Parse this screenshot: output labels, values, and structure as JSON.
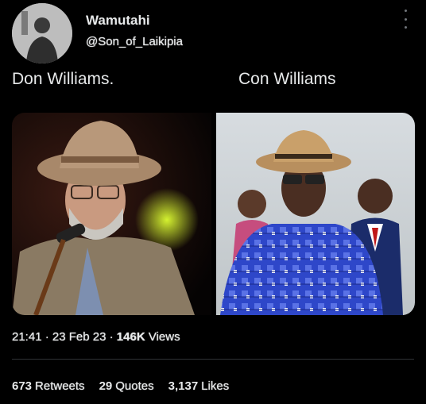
{
  "author": {
    "display_name": "Wamutahi",
    "handle": "@Son_of_Laikipia"
  },
  "tweet": {
    "text_left": "Don Williams.",
    "text_right": "Con Williams"
  },
  "meta": {
    "time": "21:41",
    "date": "23 Feb 23",
    "views_count": "146K",
    "views_label": "Views"
  },
  "stats": {
    "retweets_count": "673",
    "retweets_label": "Retweets",
    "quotes_count": "29",
    "quotes_label": "Quotes",
    "likes_count": "3,137",
    "likes_label": "Likes"
  },
  "icons": {
    "more": "more-icon"
  }
}
